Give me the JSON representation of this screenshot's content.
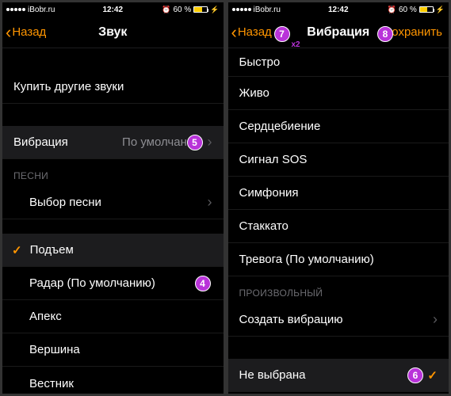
{
  "statusbar": {
    "carrier": "iBobr.ru",
    "time": "12:42",
    "battery": "60 %"
  },
  "left": {
    "nav_back": "Назад",
    "nav_title": "Звук",
    "buy_sounds": "Купить другие звуки",
    "vibration_label": "Вибрация",
    "vibration_value": "По умолчанию",
    "songs_header": "ПЕСНИ",
    "choose_song": "Выбор песни",
    "tone_rise": "Подъем",
    "tone_radar": "Радар (По умолчанию)",
    "tone_apex": "Апекс",
    "tone_summit": "Вершина",
    "tone_herald": "Вестник"
  },
  "right": {
    "nav_back": "Назад",
    "nav_title": "Вибрация",
    "nav_action": "Сохранить",
    "pat_fast": "Быстро",
    "pat_lively": "Живо",
    "pat_heartbeat": "Сердцебиение",
    "pat_sos": "Сигнал SOS",
    "pat_symphony": "Симфония",
    "pat_staccato": "Стаккато",
    "pat_alert": "Тревога (По умолчанию)",
    "custom_header": "ПРОИЗВОЛЬНЫЙ",
    "create_vib": "Создать вибрацию",
    "none_selected": "Не выбрана"
  },
  "badges": {
    "b4": "4",
    "b5": "5",
    "b6": "6",
    "b7": "7",
    "b7_sub": "x2",
    "b8": "8"
  }
}
